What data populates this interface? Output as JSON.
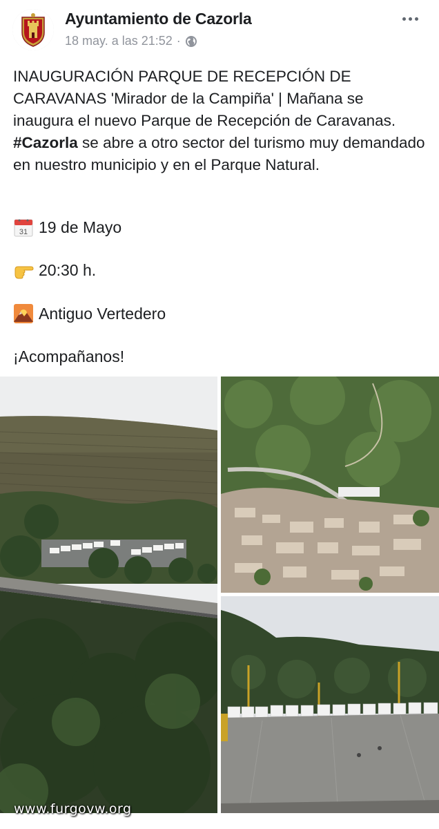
{
  "post": {
    "page_name": "Ayuntamiento de Cazorla",
    "timestamp": "18 may. a las 21:52",
    "separator": "·",
    "privacy_icon": "globe-icon",
    "more_icon": "more-options-icon",
    "text": {
      "part1": "INAUGURACIÓN PARQUE DE RECEPCIÓN DE CARAVANAS 'Mirador de la Campiña' | Mañana se inaugura el nuevo Parque de Recepción de Caravanas. ",
      "hashtag": "#Cazorla",
      "part2": " se abre a otro sector del turismo muy demandado en nuestro municipio y en el Parque Natural."
    },
    "details": [
      {
        "icon": "calendar-icon",
        "text": "19 de Mayo"
      },
      {
        "icon": "pointing-hand-icon",
        "text": "20:30 h."
      },
      {
        "icon": "sunrise-mountain-icon",
        "text": "Antiguo Vertedero"
      }
    ],
    "closing": "¡Acompañanos!"
  },
  "photos": [
    {
      "name": "photo-hillside-caravans"
    },
    {
      "name": "photo-aerial-town"
    },
    {
      "name": "photo-caravan-parking-lot"
    }
  ],
  "watermark": "www.furgovw.org"
}
